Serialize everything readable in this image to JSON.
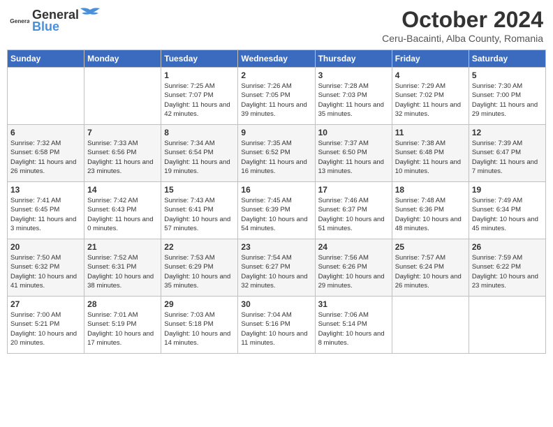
{
  "header": {
    "logo_general": "General",
    "logo_blue": "Blue",
    "month_title": "October 2024",
    "subtitle": "Ceru-Bacainti, Alba County, Romania"
  },
  "weekdays": [
    "Sunday",
    "Monday",
    "Tuesday",
    "Wednesday",
    "Thursday",
    "Friday",
    "Saturday"
  ],
  "weeks": [
    [
      {
        "day": "",
        "info": ""
      },
      {
        "day": "",
        "info": ""
      },
      {
        "day": "1",
        "info": "Sunrise: 7:25 AM\nSunset: 7:07 PM\nDaylight: 11 hours and 42 minutes."
      },
      {
        "day": "2",
        "info": "Sunrise: 7:26 AM\nSunset: 7:05 PM\nDaylight: 11 hours and 39 minutes."
      },
      {
        "day": "3",
        "info": "Sunrise: 7:28 AM\nSunset: 7:03 PM\nDaylight: 11 hours and 35 minutes."
      },
      {
        "day": "4",
        "info": "Sunrise: 7:29 AM\nSunset: 7:02 PM\nDaylight: 11 hours and 32 minutes."
      },
      {
        "day": "5",
        "info": "Sunrise: 7:30 AM\nSunset: 7:00 PM\nDaylight: 11 hours and 29 minutes."
      }
    ],
    [
      {
        "day": "6",
        "info": "Sunrise: 7:32 AM\nSunset: 6:58 PM\nDaylight: 11 hours and 26 minutes."
      },
      {
        "day": "7",
        "info": "Sunrise: 7:33 AM\nSunset: 6:56 PM\nDaylight: 11 hours and 23 minutes."
      },
      {
        "day": "8",
        "info": "Sunrise: 7:34 AM\nSunset: 6:54 PM\nDaylight: 11 hours and 19 minutes."
      },
      {
        "day": "9",
        "info": "Sunrise: 7:35 AM\nSunset: 6:52 PM\nDaylight: 11 hours and 16 minutes."
      },
      {
        "day": "10",
        "info": "Sunrise: 7:37 AM\nSunset: 6:50 PM\nDaylight: 11 hours and 13 minutes."
      },
      {
        "day": "11",
        "info": "Sunrise: 7:38 AM\nSunset: 6:48 PM\nDaylight: 11 hours and 10 minutes."
      },
      {
        "day": "12",
        "info": "Sunrise: 7:39 AM\nSunset: 6:47 PM\nDaylight: 11 hours and 7 minutes."
      }
    ],
    [
      {
        "day": "13",
        "info": "Sunrise: 7:41 AM\nSunset: 6:45 PM\nDaylight: 11 hours and 3 minutes."
      },
      {
        "day": "14",
        "info": "Sunrise: 7:42 AM\nSunset: 6:43 PM\nDaylight: 11 hours and 0 minutes."
      },
      {
        "day": "15",
        "info": "Sunrise: 7:43 AM\nSunset: 6:41 PM\nDaylight: 10 hours and 57 minutes."
      },
      {
        "day": "16",
        "info": "Sunrise: 7:45 AM\nSunset: 6:39 PM\nDaylight: 10 hours and 54 minutes."
      },
      {
        "day": "17",
        "info": "Sunrise: 7:46 AM\nSunset: 6:37 PM\nDaylight: 10 hours and 51 minutes."
      },
      {
        "day": "18",
        "info": "Sunrise: 7:48 AM\nSunset: 6:36 PM\nDaylight: 10 hours and 48 minutes."
      },
      {
        "day": "19",
        "info": "Sunrise: 7:49 AM\nSunset: 6:34 PM\nDaylight: 10 hours and 45 minutes."
      }
    ],
    [
      {
        "day": "20",
        "info": "Sunrise: 7:50 AM\nSunset: 6:32 PM\nDaylight: 10 hours and 41 minutes."
      },
      {
        "day": "21",
        "info": "Sunrise: 7:52 AM\nSunset: 6:31 PM\nDaylight: 10 hours and 38 minutes."
      },
      {
        "day": "22",
        "info": "Sunrise: 7:53 AM\nSunset: 6:29 PM\nDaylight: 10 hours and 35 minutes."
      },
      {
        "day": "23",
        "info": "Sunrise: 7:54 AM\nSunset: 6:27 PM\nDaylight: 10 hours and 32 minutes."
      },
      {
        "day": "24",
        "info": "Sunrise: 7:56 AM\nSunset: 6:26 PM\nDaylight: 10 hours and 29 minutes."
      },
      {
        "day": "25",
        "info": "Sunrise: 7:57 AM\nSunset: 6:24 PM\nDaylight: 10 hours and 26 minutes."
      },
      {
        "day": "26",
        "info": "Sunrise: 7:59 AM\nSunset: 6:22 PM\nDaylight: 10 hours and 23 minutes."
      }
    ],
    [
      {
        "day": "27",
        "info": "Sunrise: 7:00 AM\nSunset: 5:21 PM\nDaylight: 10 hours and 20 minutes."
      },
      {
        "day": "28",
        "info": "Sunrise: 7:01 AM\nSunset: 5:19 PM\nDaylight: 10 hours and 17 minutes."
      },
      {
        "day": "29",
        "info": "Sunrise: 7:03 AM\nSunset: 5:18 PM\nDaylight: 10 hours and 14 minutes."
      },
      {
        "day": "30",
        "info": "Sunrise: 7:04 AM\nSunset: 5:16 PM\nDaylight: 10 hours and 11 minutes."
      },
      {
        "day": "31",
        "info": "Sunrise: 7:06 AM\nSunset: 5:14 PM\nDaylight: 10 hours and 8 minutes."
      },
      {
        "day": "",
        "info": ""
      },
      {
        "day": "",
        "info": ""
      }
    ]
  ]
}
